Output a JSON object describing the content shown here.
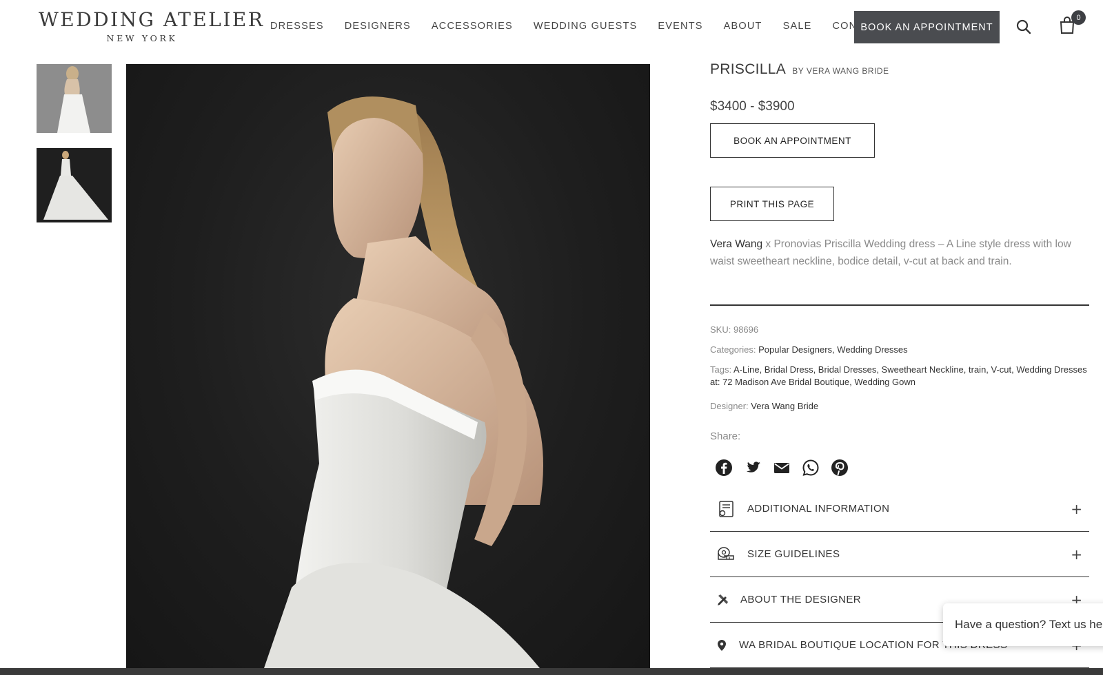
{
  "header": {
    "logo_main": "WEDDING ATELIER",
    "logo_sub": "NEW YORK",
    "nav": [
      "DRESSES",
      "DESIGNERS",
      "ACCESSORIES",
      "WEDDING GUESTS",
      "EVENTS",
      "ABOUT",
      "SALE",
      "CONTACT"
    ],
    "book_label": "BOOK AN APPOINTMENT",
    "cart_count": "0",
    "search_icon": "search-icon",
    "cart_icon": "shopping-bag-icon"
  },
  "gallery": {
    "thumbnails": [
      "dress-thumbnail-grey",
      "dress-thumbnail-dark"
    ],
    "main_image": "model-in-strapless-white-gown"
  },
  "product": {
    "name": "PRISCILLA",
    "by": "BY VERA WANG BRIDE",
    "price": "$3400 - $3900",
    "book_label": "BOOK AN APPOINTMENT",
    "print_label": "PRINT THIS PAGE",
    "desc_strong": "Vera Wang",
    "desc_rest": " x Pronovias Priscilla Wedding dress – A Line style dress with low waist sweetheart neckline, bodice detail, v-cut at back and train.",
    "sku_label": "SKU:",
    "sku": "98696",
    "categories_label": "Categories:",
    "categories": "Popular Designers, Wedding Dresses",
    "tags_label": "Tags:",
    "tags": "A-Line, Bridal Dress, Bridal Dresses, Sweetheart Neckline, train, V-cut, Wedding Dresses at: 72 Madison Ave Bridal Boutique, Wedding Gown",
    "designer_label": "Designer:",
    "designer": "Vera Wang Bride",
    "share_label": "Share:",
    "share_icons": [
      "facebook-icon",
      "twitter-icon",
      "email-icon",
      "whatsapp-icon",
      "pinterest-icon"
    ]
  },
  "accordion": [
    {
      "label": "ADDITIONAL INFORMATION",
      "icon": "info-document-icon"
    },
    {
      "label": "SIZE GUIDELINES",
      "icon": "measuring-tape-icon"
    },
    {
      "label": "ABOUT THE DESIGNER",
      "icon": "design-tools-icon"
    },
    {
      "label": "WA BRIDAL BOUTIQUE LOCATION FOR THIS DRESS",
      "icon": "location-pin-icon"
    }
  ],
  "chat": {
    "text": "Have a question? Text us here"
  },
  "colors": {
    "button_dark": "#4a4c50",
    "text_muted": "#8a8a8a"
  }
}
